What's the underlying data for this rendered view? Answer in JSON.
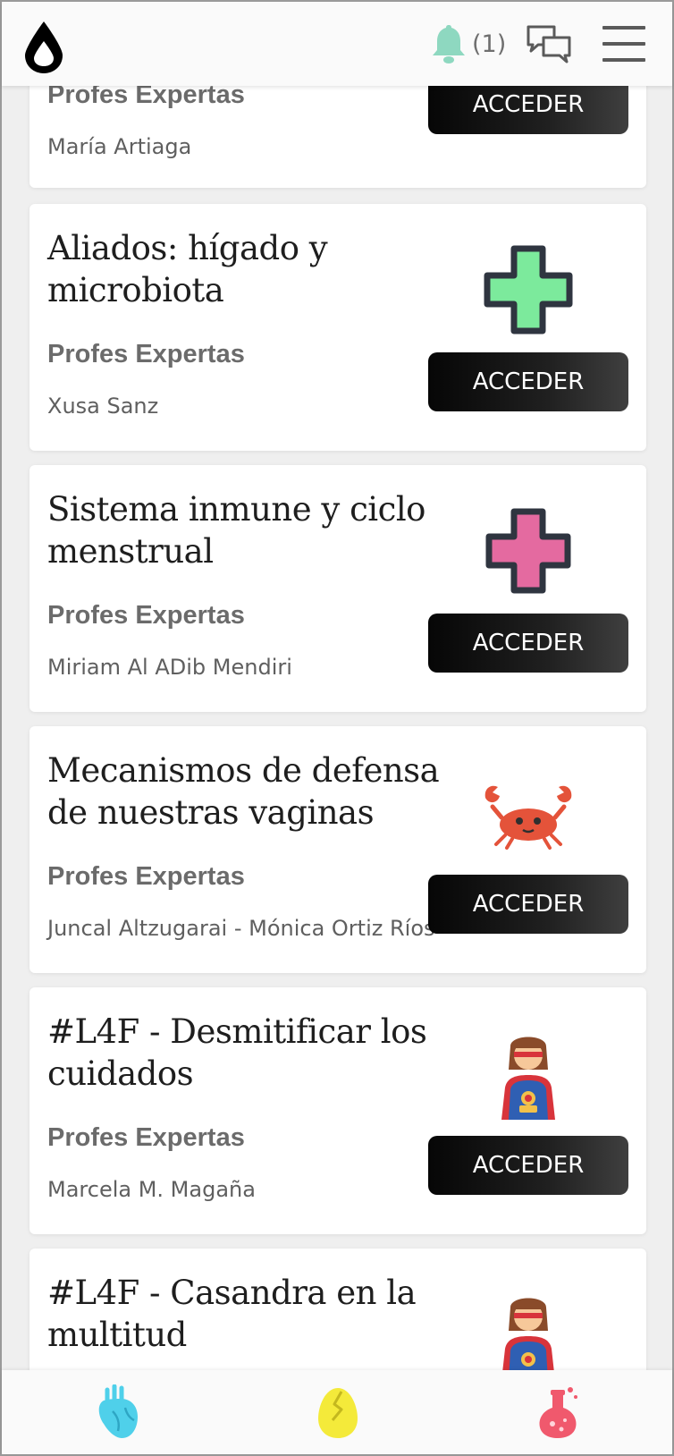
{
  "header": {
    "logo_icon": "drop-icon",
    "notification_icon": "bell-icon",
    "notification_count": "(1)",
    "chat_icon": "chat-bubbles-icon",
    "menu_icon": "hamburger-menu-icon"
  },
  "cards": [
    {
      "title": "",
      "subtitle": "Profes Expertas",
      "author": "María Artiaga",
      "button": "ACCEDER",
      "icon": ""
    },
    {
      "title": "Aliados: hígado y microbiota",
      "subtitle": "Profes Expertas",
      "author": "Xusa Sanz",
      "button": "ACCEDER",
      "icon": "green-cross-icon"
    },
    {
      "title": "Sistema inmune y ciclo menstrual",
      "subtitle": "Profes Expertas",
      "author": "Miriam Al ADib Mendiri",
      "button": "ACCEDER",
      "icon": "pink-cross-icon"
    },
    {
      "title": "Mecanismos de defensa de nuestras vaginas",
      "subtitle": "Profes Expertas",
      "author": "Juncal Altzugarai - Mónica Ortiz Ríos",
      "button": "ACCEDER",
      "icon": "crab-icon"
    },
    {
      "title": "#L4F - Desmitificar los cuidados",
      "subtitle": "Profes Expertas",
      "author": "Marcela M. Magaña",
      "button": "ACCEDER",
      "icon": "superhero-woman-icon"
    },
    {
      "title": "#L4F - Casandra en la multitud",
      "subtitle": "",
      "author": "",
      "button": "",
      "icon": "superhero-woman-icon"
    }
  ],
  "bottom_nav": [
    {
      "icon": "anatomical-heart-icon",
      "color": "#4fd0ea"
    },
    {
      "icon": "cracked-egg-icon",
      "color": "#f4ea3a"
    },
    {
      "icon": "flask-icon",
      "color": "#f0596d"
    }
  ],
  "colors": {
    "accent_bell": "#8ed8c0",
    "button_bg": "#0c0c0c",
    "card_bg": "#ffffff",
    "page_bg": "#efefef"
  }
}
